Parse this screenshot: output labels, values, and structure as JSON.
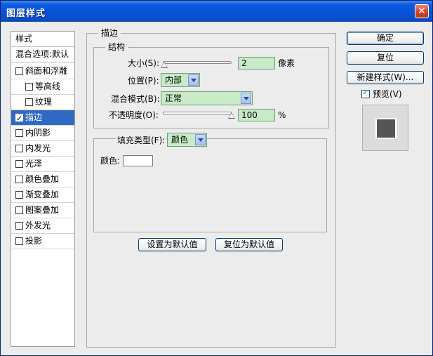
{
  "window": {
    "title": "图层样式",
    "close": "✕"
  },
  "left_panel": {
    "header": "样式",
    "blend_options": "混合选项:默认",
    "items": [
      {
        "label": "斜面和浮雕",
        "checked": false
      },
      {
        "label": "等高线",
        "checked": false
      },
      {
        "label": "纹理",
        "checked": false
      },
      {
        "label": "描边",
        "checked": true,
        "selected": true
      },
      {
        "label": "内阴影",
        "checked": false
      },
      {
        "label": "内发光",
        "checked": false
      },
      {
        "label": "光泽",
        "checked": false
      },
      {
        "label": "颜色叠加",
        "checked": false
      },
      {
        "label": "渐变叠加",
        "checked": false
      },
      {
        "label": "图案叠加",
        "checked": false
      },
      {
        "label": "外发光",
        "checked": false
      },
      {
        "label": "投影",
        "checked": false
      }
    ]
  },
  "stroke": {
    "group_title": "描边",
    "structure_title": "结构",
    "size": {
      "label": "大小(S):",
      "value": "2",
      "unit": "像素",
      "slider_fraction": 0.01
    },
    "position": {
      "label": "位置(P):",
      "value": "内部"
    },
    "blend_mode": {
      "label": "混合模式(B):",
      "value": "正常"
    },
    "opacity": {
      "label": "不透明度(O):",
      "value": "100",
      "unit": "%",
      "slider_fraction": 1.0
    },
    "fill_type": {
      "label": "填充类型(F):",
      "value": "颜色"
    },
    "color": {
      "label": "颜色:",
      "value": "#ffffff"
    }
  },
  "buttons": {
    "make_default": "设置为默认值",
    "reset_default": "复位为默认值",
    "ok": "确定",
    "reset": "复位",
    "new_style": "新建样式(W)...",
    "preview": "预览(V)"
  },
  "colors": {
    "title_bar": "#0652d8",
    "selection": "#316ac5",
    "field": "#c6ebc6"
  }
}
